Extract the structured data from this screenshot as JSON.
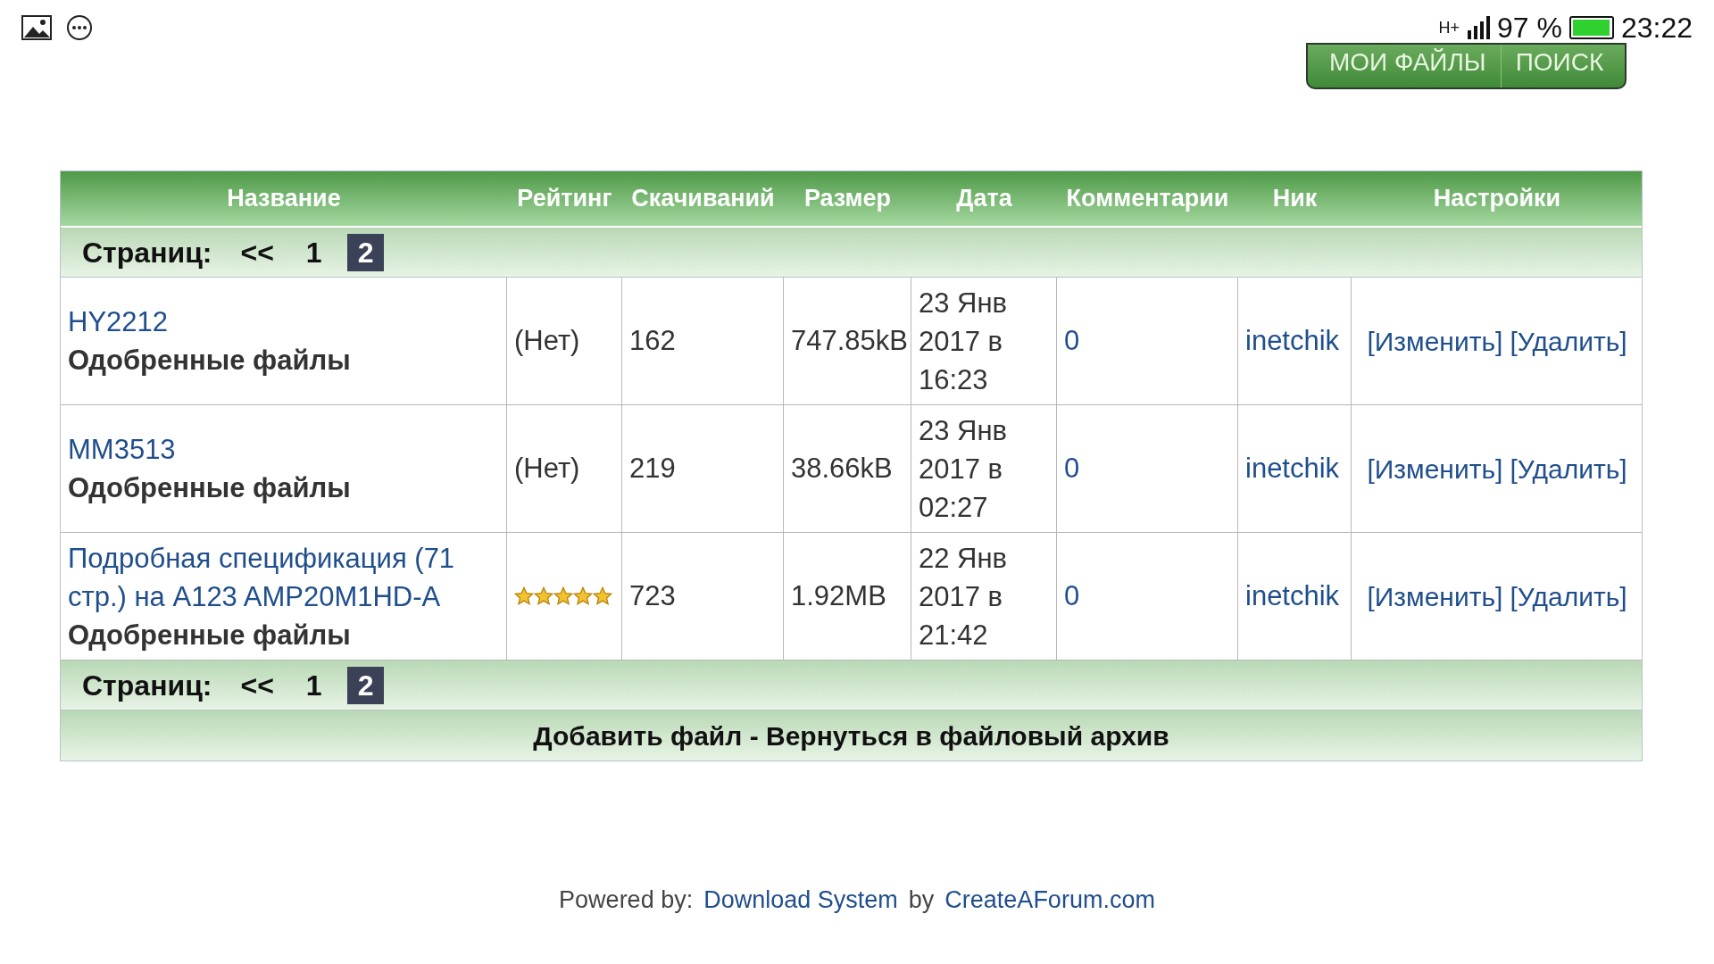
{
  "status_bar": {
    "network": "H+",
    "battery_text": "97 %",
    "battery": {
      "level": 0.97
    },
    "time": "23:22"
  },
  "top_nav": [
    {
      "label": "МОИ ФАЙЛЫ"
    },
    {
      "label": "ПОИСК"
    }
  ],
  "table": {
    "columns": [
      "Название",
      "Рейтинг",
      "Скачиваний",
      "Размер",
      "Дата",
      "Комментарии",
      "Ник",
      "Настройки"
    ],
    "pager_top": {
      "label": "Страниц:",
      "prev": "<<",
      "pages": [
        {
          "label": "1",
          "selected": false
        },
        {
          "label": "2",
          "selected": true
        }
      ]
    },
    "rows": [
      {
        "title": "HY2212",
        "category": "Одобренные файлы",
        "rating": {
          "kind": "text",
          "text": "(Нет)"
        },
        "downloads": "162",
        "size": "747.85kB",
        "date": "23 Янв 2017 в 16:23",
        "comments": "0",
        "nick": "inetchik",
        "actions": [
          "[Изменить]",
          "[Удалить]"
        ]
      },
      {
        "title": "MM3513",
        "category": "Одобренные файлы",
        "rating": {
          "kind": "text",
          "text": "(Нет)"
        },
        "downloads": "219",
        "size": "38.66kB",
        "date": "23 Янв 2017 в 02:27",
        "comments": "0",
        "nick": "inetchik",
        "actions": [
          "[Изменить]",
          "[Удалить]"
        ]
      },
      {
        "title": "Подробная спецификация (71 стр.) на A123 AMP20M1HD-A",
        "category": "Одобренные файлы",
        "rating": {
          "kind": "stars",
          "stars": 5
        },
        "downloads": "723",
        "size": "1.92MB",
        "date": "22 Янв 2017 в 21:42",
        "comments": "0",
        "nick": "inetchik",
        "actions": [
          "[Изменить]",
          "[Удалить]"
        ]
      }
    ],
    "pager_bottom": {
      "label": "Страниц:",
      "prev": "<<",
      "pages": [
        {
          "label": "1",
          "selected": false
        },
        {
          "label": "2",
          "selected": true
        }
      ]
    },
    "footer_links": "Добавить файл - Вернуться в файловый архив"
  },
  "powered": {
    "prefix": "Powered by:",
    "link1": "Download System",
    "middle": "by",
    "link2": "CreateAForum.com"
  }
}
